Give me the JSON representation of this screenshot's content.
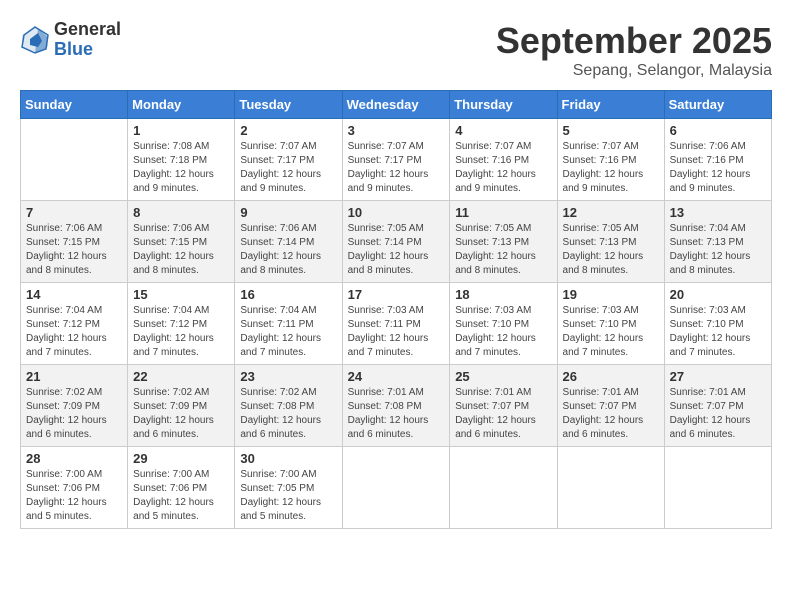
{
  "logo": {
    "general": "General",
    "blue": "Blue"
  },
  "header": {
    "month": "September 2025",
    "location": "Sepang, Selangor, Malaysia"
  },
  "weekdays": [
    "Sunday",
    "Monday",
    "Tuesday",
    "Wednesday",
    "Thursday",
    "Friday",
    "Saturday"
  ],
  "weeks": [
    [
      {
        "day": "",
        "sunrise": "",
        "sunset": "",
        "daylight": ""
      },
      {
        "day": "1",
        "sunrise": "Sunrise: 7:08 AM",
        "sunset": "Sunset: 7:18 PM",
        "daylight": "Daylight: 12 hours and 9 minutes."
      },
      {
        "day": "2",
        "sunrise": "Sunrise: 7:07 AM",
        "sunset": "Sunset: 7:17 PM",
        "daylight": "Daylight: 12 hours and 9 minutes."
      },
      {
        "day": "3",
        "sunrise": "Sunrise: 7:07 AM",
        "sunset": "Sunset: 7:17 PM",
        "daylight": "Daylight: 12 hours and 9 minutes."
      },
      {
        "day": "4",
        "sunrise": "Sunrise: 7:07 AM",
        "sunset": "Sunset: 7:16 PM",
        "daylight": "Daylight: 12 hours and 9 minutes."
      },
      {
        "day": "5",
        "sunrise": "Sunrise: 7:07 AM",
        "sunset": "Sunset: 7:16 PM",
        "daylight": "Daylight: 12 hours and 9 minutes."
      },
      {
        "day": "6",
        "sunrise": "Sunrise: 7:06 AM",
        "sunset": "Sunset: 7:16 PM",
        "daylight": "Daylight: 12 hours and 9 minutes."
      }
    ],
    [
      {
        "day": "7",
        "sunrise": "Sunrise: 7:06 AM",
        "sunset": "Sunset: 7:15 PM",
        "daylight": "Daylight: 12 hours and 8 minutes."
      },
      {
        "day": "8",
        "sunrise": "Sunrise: 7:06 AM",
        "sunset": "Sunset: 7:15 PM",
        "daylight": "Daylight: 12 hours and 8 minutes."
      },
      {
        "day": "9",
        "sunrise": "Sunrise: 7:06 AM",
        "sunset": "Sunset: 7:14 PM",
        "daylight": "Daylight: 12 hours and 8 minutes."
      },
      {
        "day": "10",
        "sunrise": "Sunrise: 7:05 AM",
        "sunset": "Sunset: 7:14 PM",
        "daylight": "Daylight: 12 hours and 8 minutes."
      },
      {
        "day": "11",
        "sunrise": "Sunrise: 7:05 AM",
        "sunset": "Sunset: 7:13 PM",
        "daylight": "Daylight: 12 hours and 8 minutes."
      },
      {
        "day": "12",
        "sunrise": "Sunrise: 7:05 AM",
        "sunset": "Sunset: 7:13 PM",
        "daylight": "Daylight: 12 hours and 8 minutes."
      },
      {
        "day": "13",
        "sunrise": "Sunrise: 7:04 AM",
        "sunset": "Sunset: 7:13 PM",
        "daylight": "Daylight: 12 hours and 8 minutes."
      }
    ],
    [
      {
        "day": "14",
        "sunrise": "Sunrise: 7:04 AM",
        "sunset": "Sunset: 7:12 PM",
        "daylight": "Daylight: 12 hours and 7 minutes."
      },
      {
        "day": "15",
        "sunrise": "Sunrise: 7:04 AM",
        "sunset": "Sunset: 7:12 PM",
        "daylight": "Daylight: 12 hours and 7 minutes."
      },
      {
        "day": "16",
        "sunrise": "Sunrise: 7:04 AM",
        "sunset": "Sunset: 7:11 PM",
        "daylight": "Daylight: 12 hours and 7 minutes."
      },
      {
        "day": "17",
        "sunrise": "Sunrise: 7:03 AM",
        "sunset": "Sunset: 7:11 PM",
        "daylight": "Daylight: 12 hours and 7 minutes."
      },
      {
        "day": "18",
        "sunrise": "Sunrise: 7:03 AM",
        "sunset": "Sunset: 7:10 PM",
        "daylight": "Daylight: 12 hours and 7 minutes."
      },
      {
        "day": "19",
        "sunrise": "Sunrise: 7:03 AM",
        "sunset": "Sunset: 7:10 PM",
        "daylight": "Daylight: 12 hours and 7 minutes."
      },
      {
        "day": "20",
        "sunrise": "Sunrise: 7:03 AM",
        "sunset": "Sunset: 7:10 PM",
        "daylight": "Daylight: 12 hours and 7 minutes."
      }
    ],
    [
      {
        "day": "21",
        "sunrise": "Sunrise: 7:02 AM",
        "sunset": "Sunset: 7:09 PM",
        "daylight": "Daylight: 12 hours and 6 minutes."
      },
      {
        "day": "22",
        "sunrise": "Sunrise: 7:02 AM",
        "sunset": "Sunset: 7:09 PM",
        "daylight": "Daylight: 12 hours and 6 minutes."
      },
      {
        "day": "23",
        "sunrise": "Sunrise: 7:02 AM",
        "sunset": "Sunset: 7:08 PM",
        "daylight": "Daylight: 12 hours and 6 minutes."
      },
      {
        "day": "24",
        "sunrise": "Sunrise: 7:01 AM",
        "sunset": "Sunset: 7:08 PM",
        "daylight": "Daylight: 12 hours and 6 minutes."
      },
      {
        "day": "25",
        "sunrise": "Sunrise: 7:01 AM",
        "sunset": "Sunset: 7:07 PM",
        "daylight": "Daylight: 12 hours and 6 minutes."
      },
      {
        "day": "26",
        "sunrise": "Sunrise: 7:01 AM",
        "sunset": "Sunset: 7:07 PM",
        "daylight": "Daylight: 12 hours and 6 minutes."
      },
      {
        "day": "27",
        "sunrise": "Sunrise: 7:01 AM",
        "sunset": "Sunset: 7:07 PM",
        "daylight": "Daylight: 12 hours and 6 minutes."
      }
    ],
    [
      {
        "day": "28",
        "sunrise": "Sunrise: 7:00 AM",
        "sunset": "Sunset: 7:06 PM",
        "daylight": "Daylight: 12 hours and 5 minutes."
      },
      {
        "day": "29",
        "sunrise": "Sunrise: 7:00 AM",
        "sunset": "Sunset: 7:06 PM",
        "daylight": "Daylight: 12 hours and 5 minutes."
      },
      {
        "day": "30",
        "sunrise": "Sunrise: 7:00 AM",
        "sunset": "Sunset: 7:05 PM",
        "daylight": "Daylight: 12 hours and 5 minutes."
      },
      {
        "day": "",
        "sunrise": "",
        "sunset": "",
        "daylight": ""
      },
      {
        "day": "",
        "sunrise": "",
        "sunset": "",
        "daylight": ""
      },
      {
        "day": "",
        "sunrise": "",
        "sunset": "",
        "daylight": ""
      },
      {
        "day": "",
        "sunrise": "",
        "sunset": "",
        "daylight": ""
      }
    ]
  ]
}
